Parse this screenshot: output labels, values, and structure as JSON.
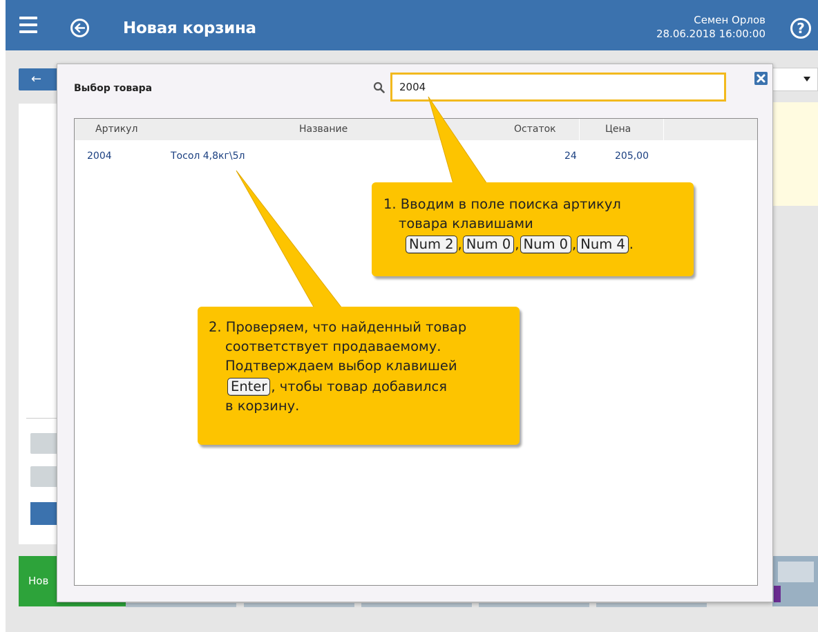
{
  "header": {
    "title": "Новая корзина",
    "user_name": "Семен Орлов",
    "datetime": "28.06.2018 16:00:00",
    "help_label": "?"
  },
  "background": {
    "back_arrow": "←",
    "green_button_label": "Нов",
    "small_button_glyph_1": "∪",
    "small_button_glyph_2": "∪"
  },
  "dialog": {
    "title": "Выбор товара",
    "search_value": "2004",
    "columns": [
      "Артикул",
      "Название",
      "Остаток",
      "Цена"
    ],
    "rows": [
      {
        "sku": "2004",
        "name": "Тосол 4,8кг\\5л",
        "stock": "24",
        "price": "205,00"
      }
    ]
  },
  "callouts": {
    "step1": {
      "line1": "1. Вводим в поле поиска артикул",
      "line2": "товара клавишами",
      "keys": [
        "Num 2",
        "Num 0",
        "Num 0",
        "Num 4"
      ],
      "separator": ",",
      "end": "."
    },
    "step2": {
      "line1": "2. Проверяем, что найденный товар",
      "line2": "соответствует продаваемому.",
      "line3": "Подтверждаем выбор клавишей",
      "key": "Enter",
      "line4_rest": ", чтобы товар добавился",
      "line5": "в корзину."
    }
  },
  "colors": {
    "header_bg": "#3b72ae",
    "callout_bg": "#fdc400",
    "search_border": "#f2b91e",
    "accent_green": "#2da33a"
  },
  "icons": {
    "menu": "hamburger-icon",
    "back": "back-arrow-circle-icon",
    "help": "help-circle-icon",
    "search": "search-icon",
    "close": "close-icon"
  }
}
